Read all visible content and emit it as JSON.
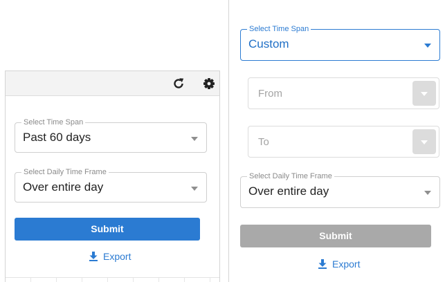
{
  "left_panel": {
    "toolbar": {
      "refresh_icon": "refresh-icon",
      "settings_icon": "gear-icon"
    },
    "time_span": {
      "label": "Select Time Span",
      "value": "Past 60 days"
    },
    "daily_time_frame": {
      "label": "Select Daily Time Frame",
      "value": "Over entire day"
    },
    "submit_label": "Submit",
    "export_label": "Export"
  },
  "right_panel": {
    "time_span": {
      "label": "Select Time Span",
      "value": "Custom"
    },
    "from": {
      "placeholder": "From"
    },
    "to": {
      "placeholder": "To"
    },
    "daily_time_frame": {
      "label": "Select Daily Time Frame",
      "value": "Over entire day"
    },
    "submit_label": "Submit",
    "export_label": "Export"
  },
  "colors": {
    "accent": "#2b7bd2",
    "disabled": "#a9a9a9",
    "border": "#cfcfcf"
  }
}
